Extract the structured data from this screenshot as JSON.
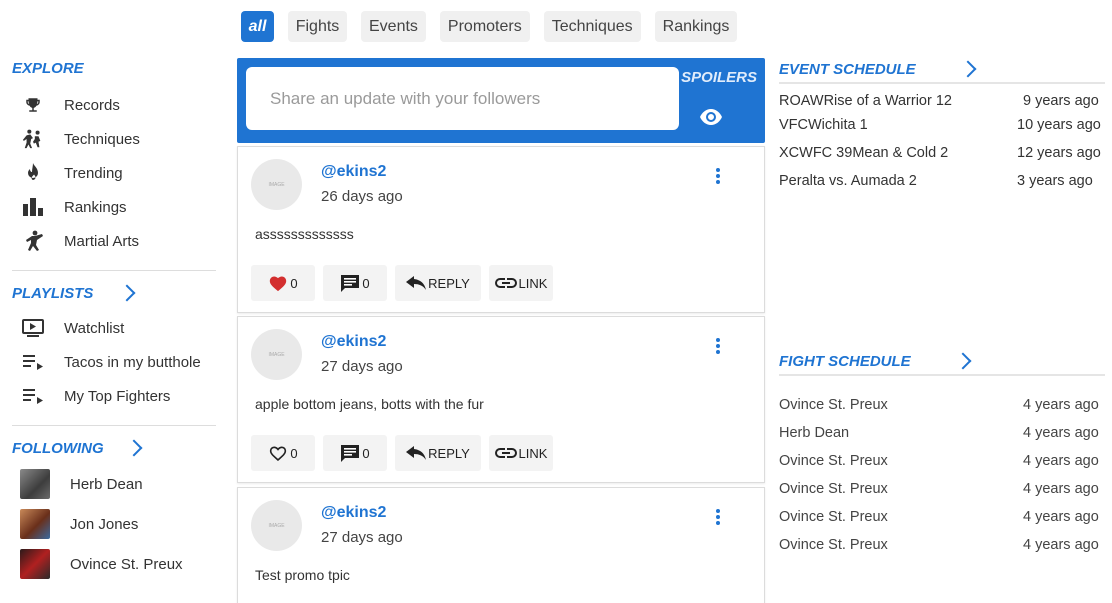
{
  "tabs": [
    "all",
    "Fights",
    "Events",
    "Promoters",
    "Techniques",
    "Rankings"
  ],
  "sidebar": {
    "explore_title": "EXPLORE",
    "explore_items": [
      "Records",
      "Techniques",
      "Trending",
      "Rankings",
      "Martial Arts"
    ],
    "playlists_title": "PLAYLISTS",
    "playlist_items": [
      "Watchlist",
      "Tacos in my butthole",
      "My Top Fighters"
    ],
    "following_title": "FOLLOWING",
    "following_items": [
      "Herb Dean",
      "Jon Jones",
      "Ovince St. Preux"
    ]
  },
  "composer": {
    "placeholder": "Share an update with your followers",
    "spoilers_label": "SPOILERS"
  },
  "posts": [
    {
      "avatar_text": "IMAGE",
      "handle": "@ekins2",
      "time": "26 days ago",
      "body": "asssssssssssss",
      "likes": "0",
      "comments": "0",
      "liked": true
    },
    {
      "avatar_text": "IMAGE",
      "handle": "@ekins2",
      "time": "27 days ago",
      "body": "apple bottom jeans, botts with the fur",
      "likes": "0",
      "comments": "0",
      "liked": false
    },
    {
      "avatar_text": "IMAGE",
      "handle": "@ekins2",
      "time": "27 days ago",
      "body": "Test promo tpic"
    }
  ],
  "actions": {
    "reply": "REPLY",
    "link": "LINK"
  },
  "event_schedule": {
    "title": "EVENT SCHEDULE",
    "rows": [
      {
        "name": "ROAWRise of a Warrior 12",
        "when": "9 years ago"
      },
      {
        "name": "VFCWichita 1",
        "when": "10 years ago"
      },
      {
        "name": "XCWFC 39Mean & Cold 2",
        "when": "12 years ago"
      },
      {
        "name": "Peralta vs. Aumada 2",
        "when": "3 years ago"
      }
    ]
  },
  "fight_schedule": {
    "title": "FIGHT SCHEDULE",
    "rows": [
      {
        "name": "Ovince St. Preux",
        "when": "4 years ago"
      },
      {
        "name": "Herb Dean",
        "when": "4 years ago"
      },
      {
        "name": "Ovince St. Preux",
        "when": "4 years ago"
      },
      {
        "name": "Ovince St. Preux",
        "when": "4 years ago"
      },
      {
        "name": "Ovince St. Preux",
        "when": "4 years ago"
      },
      {
        "name": "Ovince St. Preux",
        "when": "4 years ago"
      }
    ]
  },
  "colors": {
    "accent": "#1f74d2",
    "like_red": "#d32f2f"
  }
}
